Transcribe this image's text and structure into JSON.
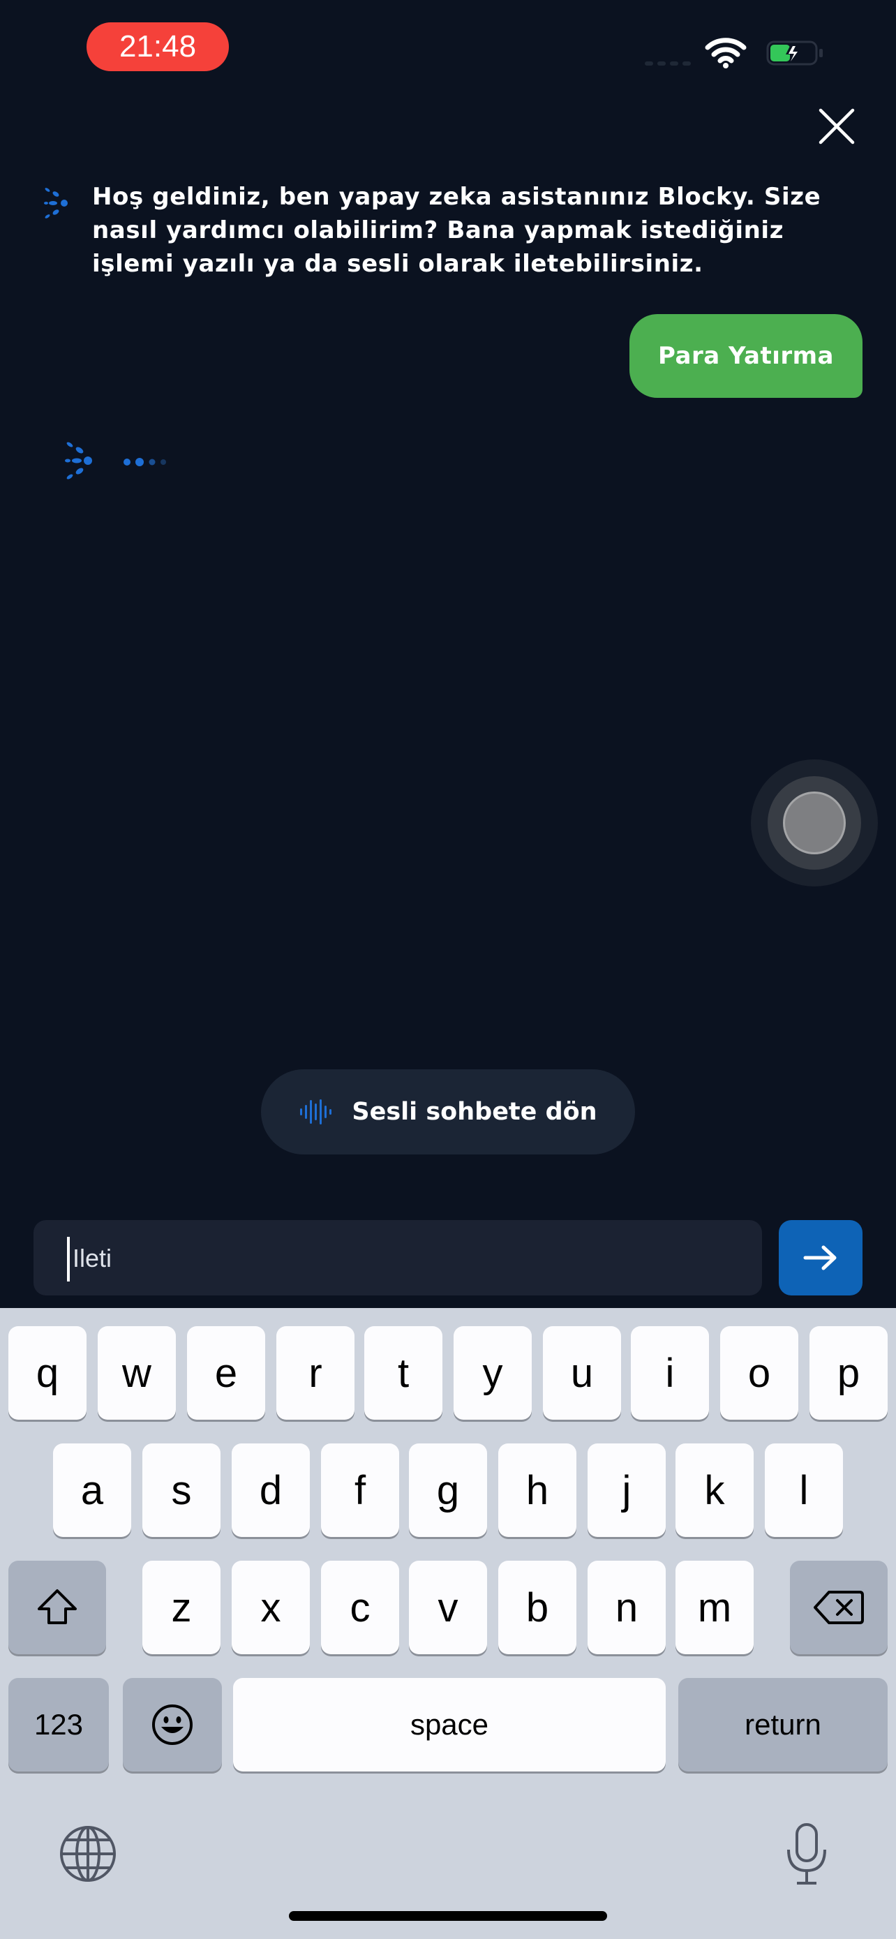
{
  "status_bar": {
    "time": "21:48"
  },
  "chat": {
    "bot_message": "Hoş geldiniz, ben yapay zeka asistanınız Blocky. Size nasıl yardımcı olabilirim? Bana yapmak istediğiniz işlemi yazılı ya da sesli olarak iletebilirsiniz.",
    "user_message": "Para Yatırma"
  },
  "voice_chat_button": {
    "label": "Sesli sohbete dön"
  },
  "composer": {
    "value": "Ileti"
  },
  "colors": {
    "background": "#0b1220",
    "user_bubble": "#4caf50",
    "send_button": "#0e63b6",
    "accent_blue": "#1e6fd6"
  },
  "keyboard": {
    "row1": [
      "q",
      "w",
      "e",
      "r",
      "t",
      "y",
      "u",
      "i",
      "o",
      "p"
    ],
    "row2": [
      "a",
      "s",
      "d",
      "f",
      "g",
      "h",
      "j",
      "k",
      "l"
    ],
    "row3": [
      "z",
      "x",
      "c",
      "v",
      "b",
      "n",
      "m"
    ],
    "numbers_label": "123",
    "space_label": "space",
    "return_label": "return",
    "icons": [
      "shift-icon",
      "backspace-icon",
      "emoji-icon",
      "globe-icon",
      "microphone-icon"
    ]
  }
}
